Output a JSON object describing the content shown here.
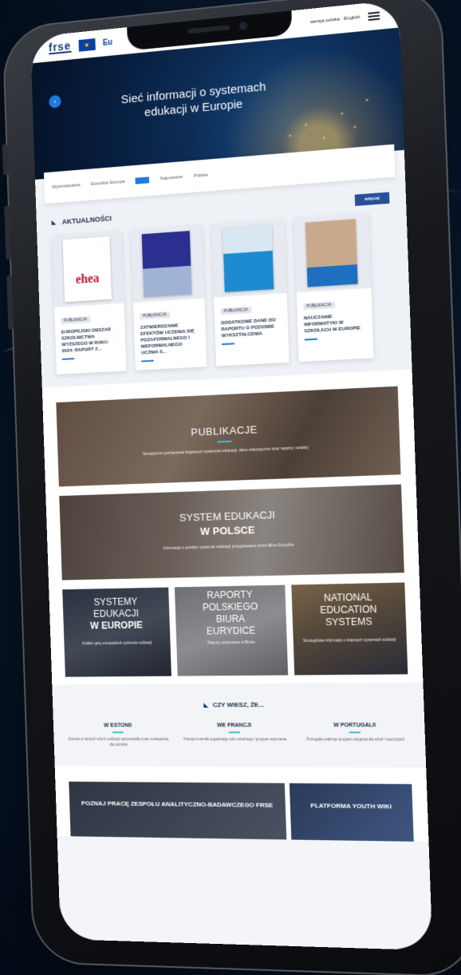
{
  "site": {
    "logo_text": "frse",
    "eu_text": "Eu",
    "top_links": "wersja polska · English"
  },
  "hero": {
    "title": "Sieć informacji o systemach edukacji w Europie",
    "back_icon": "chevron-left-icon"
  },
  "searchbar": {
    "field1": "Wyszukiwanie",
    "field2": "Eurydice Europa",
    "option1": "Najnowsze",
    "option2": "Polska",
    "colors": {
      "button": "#1f7ae0"
    }
  },
  "news": {
    "heading": "AKTUALNOŚCI",
    "more_label": "więcej",
    "cards": [
      {
        "cover_text": "ehea",
        "tag": "PUBLIKACJA",
        "title": "EUROPEJSKI OBSZAR SZKOLNICTWA WYŻSZEGO W ROKU 2024: RAPORT Z..."
      },
      {
        "cover_text": "",
        "tag": "PUBLIKACJA",
        "title": "ZATWIERDZANIE EFEKTÓW UCZENIA SIĘ POZAFORMALNEGO I NIEFORMALNEGO UCZNIA S..."
      },
      {
        "cover_text": "",
        "tag": "PUBLIKACJA",
        "title": "DODATKOWE DANE DO RAPORTU O POZIOMIE WYKSZTAŁCENIA"
      },
      {
        "cover_text": "",
        "tag": "PUBLIKACJA",
        "title": "NAUCZANIE INFORMATYKI W SZKOŁACH W EUROPIE"
      }
    ]
  },
  "tiles": {
    "publikacje": {
      "title": "PUBLIKACJE",
      "subtitle": "Tematyczne porównania krajowych systemów edukacji, dane statystyczne oraz raporty i analizy"
    },
    "system": {
      "title_line1": "SYSTEM EDUKACJI",
      "title_line2": "W POLSCE",
      "subtitle": "Informacje o polskim systemie edukacji przygotowane przez Biuro Eurydice"
    },
    "small": [
      {
        "line1": "SYSTEMY",
        "line2": "EDUKACJI",
        "line3": "W EUROPIE",
        "subtitle": "Krótkie opisy europejskich systemów edukacji"
      },
      {
        "line1": "RAPORTY",
        "line2": "POLSKIEGO",
        "line3": "BIURA",
        "line4": "EURYDICE",
        "subtitle": "Raporty opracowane w Biurze"
      },
      {
        "line1": "NATIONAL",
        "line2": "EDUCATION",
        "line3": "SYSTEMS",
        "subtitle": "Szczegółowe informacje o krajowych systemach edukacji"
      }
    ]
  },
  "didyou": {
    "heading": "CZY WIESZ, ŻE...",
    "facts": [
      {
        "title": "W ESTONII",
        "text": "Estonia w ramach reform edukacji wprowadziła nowe rozwiązania dla uczniów"
      },
      {
        "title": "WE FRANCJI",
        "text": "Francja zmieniła organizację roku szkolnego i program nauczania"
      },
      {
        "title": "W PORTUGALII",
        "text": "Portugalia realizuje program wsparcia dla szkół i nauczycieli"
      }
    ]
  },
  "bottom": {
    "left": "POZNAJ PRACĘ ZESPOŁU ANALITYCZNO-BADAWCZEGO FRSE",
    "right": "PLATFORMA YOUTH WIKI"
  }
}
